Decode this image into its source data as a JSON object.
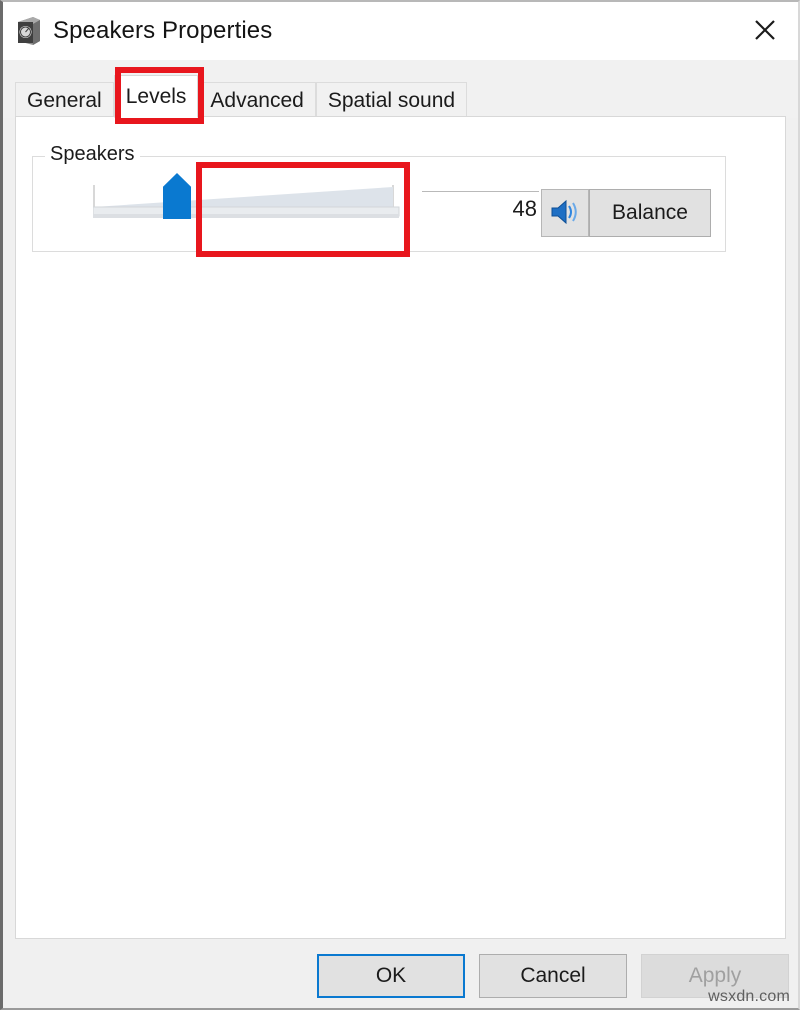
{
  "window": {
    "title": "Speakers Properties",
    "icon": "speaker-icon",
    "close_label": "✕"
  },
  "tabs": [
    {
      "label": "General",
      "selected": false
    },
    {
      "label": "Levels",
      "selected": true
    },
    {
      "label": "Advanced",
      "selected": false
    },
    {
      "label": "Spatial sound",
      "selected": false
    }
  ],
  "levels_panel": {
    "group_title": "Speakers",
    "volume": {
      "value": "48",
      "min": 0,
      "max": 100,
      "thumb_color": "#0a79d0"
    },
    "mute_button": {
      "icon": "speaker-volume-icon",
      "state": "unmuted"
    },
    "balance_button_label": "Balance"
  },
  "footer": {
    "ok_label": "OK",
    "cancel_label": "Cancel",
    "apply_label": "Apply",
    "apply_disabled": true
  },
  "watermark": "wsxdn.com",
  "annotations": [
    {
      "name": "levels-tab-highlight",
      "color": "#e8161d"
    },
    {
      "name": "volume-slider-highlight",
      "color": "#e8161d"
    }
  ]
}
